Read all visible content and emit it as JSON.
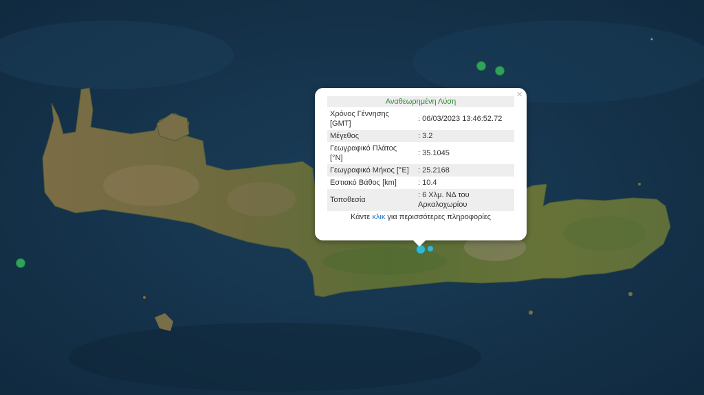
{
  "map": {
    "background": "#15334c",
    "land_colors": [
      "#6a6a3e",
      "#7a6f48",
      "#4f6a34",
      "#8a7b58"
    ]
  },
  "markers": [
    {
      "type": "recent",
      "color": "#2fa35a"
    },
    {
      "type": "recent",
      "color": "#2fa35a"
    },
    {
      "type": "recent",
      "color": "#2fa35a"
    },
    {
      "type": "selected",
      "color": "#39b6c9"
    },
    {
      "type": "selected",
      "color": "#39b6c9"
    }
  ],
  "popup": {
    "title": "Αναθεωρημένη Λύση",
    "close_symbol": "×",
    "rows": [
      {
        "key": "Χρόνος Γέννησης [GMT]",
        "value": ": 06/03/2023 13:46:52.72"
      },
      {
        "key": "Μέγεθος",
        "value": ": 3.2"
      },
      {
        "key": "Γεωγραφικό Πλάτος [°N]",
        "value": ": 35.1045"
      },
      {
        "key": "Γεωγραφικό Μήκος [°E]",
        "value": ": 25.2168"
      },
      {
        "key": "Εστιακό Βάθος [km]",
        "value": ": 10.4"
      },
      {
        "key": "Τοποθεσία",
        "value": ": 6 Χλμ. ΝΔ του Αρκαλοχωρίου"
      }
    ],
    "more_prefix": "Κάντε ",
    "more_link": "κλικ",
    "more_suffix": " για περισσότερες πληροφορίες",
    "title_color": "#2e8a32",
    "link_color": "#1a73c7"
  }
}
